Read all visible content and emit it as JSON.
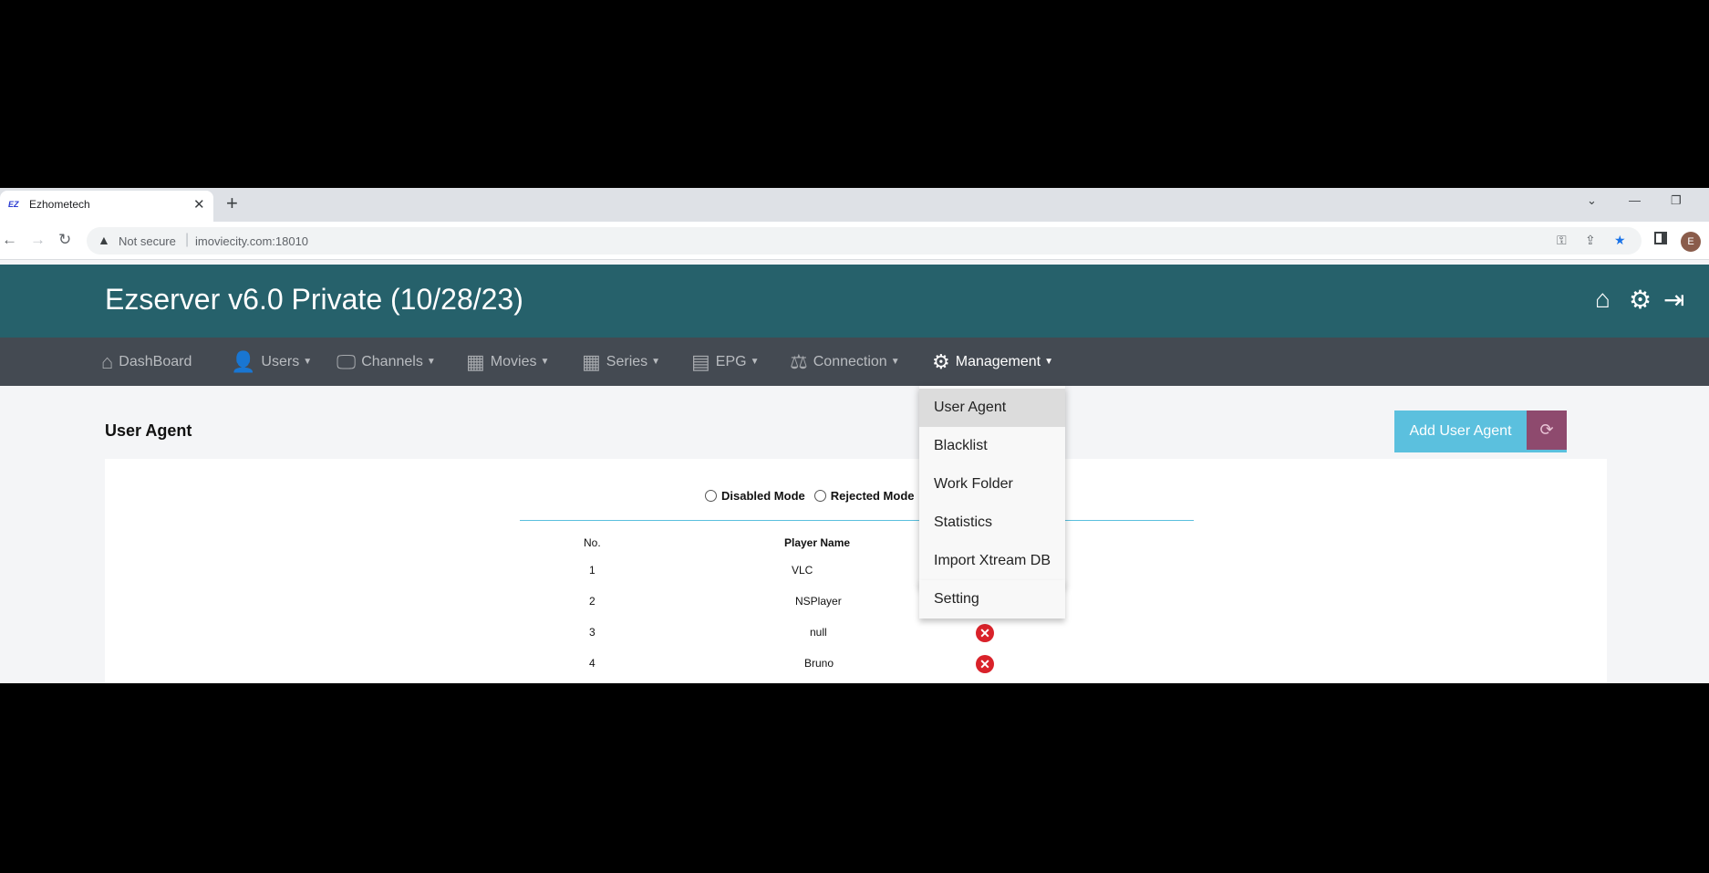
{
  "browser": {
    "tab_favicon": "EZ",
    "tab_title": "Ezhometech",
    "new_tab": "+",
    "security_label": "Not secure",
    "url": "imoviecity.com:18010",
    "profile_initial": "E"
  },
  "app": {
    "title": "Ezserver v6.0 Private (10/28/23)",
    "header_icons": [
      "home-icon",
      "gear-icon",
      "logout-icon"
    ]
  },
  "nav": {
    "items": [
      {
        "label": "DashBoard",
        "icon": "home-icon"
      },
      {
        "label": "Users",
        "icon": "user-icon"
      },
      {
        "label": "Channels",
        "icon": "monitor-icon"
      },
      {
        "label": "Movies",
        "icon": "film-icon"
      },
      {
        "label": "Series",
        "icon": "film-icon"
      },
      {
        "label": "EPG",
        "icon": "list-icon"
      },
      {
        "label": "Connection",
        "icon": "scale-icon"
      },
      {
        "label": "Management",
        "icon": "gear-icon"
      }
    ]
  },
  "management_menu": {
    "items": [
      "User Agent",
      "Blacklist",
      "Work Folder",
      "Statistics",
      "Import Xtream DB",
      "Setting"
    ],
    "active": "User Agent"
  },
  "page": {
    "title": "User Agent",
    "add_button": "Add User Agent",
    "modes": [
      "Disabled Mode",
      "Rejected Mode"
    ],
    "table": {
      "headers": [
        "No.",
        "Player Name"
      ],
      "rows": [
        {
          "no": "1",
          "player": "VLC",
          "delete": false
        },
        {
          "no": "2",
          "player": "NSPlayer",
          "delete": false
        },
        {
          "no": "3",
          "player": "null",
          "delete": true
        },
        {
          "no": "4",
          "player": "Bruno",
          "delete": true
        }
      ]
    }
  },
  "colors": {
    "header_bg": "#26616b",
    "nav_bg": "#444a52",
    "add_button": "#5bc0de",
    "refresh_button": "#8e4a6e",
    "delete_icon": "#d9222a"
  }
}
